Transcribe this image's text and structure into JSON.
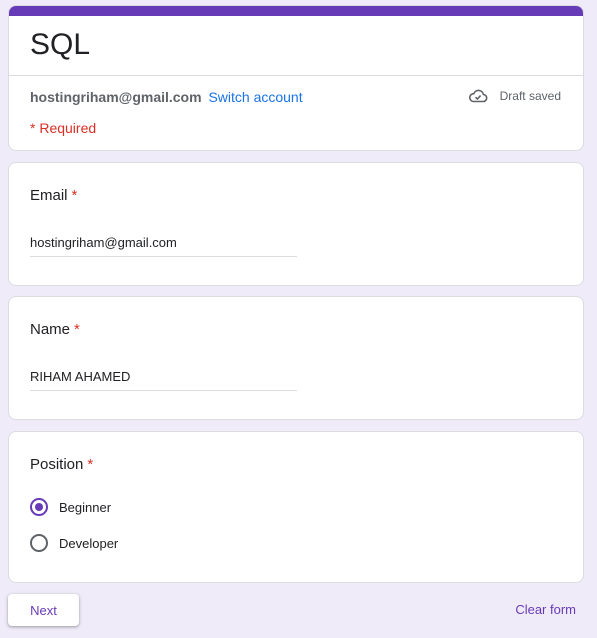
{
  "form": {
    "title": "SQL",
    "account_email": "hostingriham@gmail.com",
    "switch_account_label": "Switch account",
    "draft_status": "Draft saved",
    "required_note": "* Required",
    "accent_color": "#673ab7"
  },
  "questions": [
    {
      "label": "Email",
      "required_mark": "*",
      "value": "hostingriham@gmail.com"
    },
    {
      "label": "Name",
      "required_mark": "*",
      "value": "RIHAM AHAMED"
    },
    {
      "label": "Position",
      "required_mark": "*",
      "options": [
        {
          "label": "Beginner",
          "selected": true
        },
        {
          "label": "Developer",
          "selected": false
        }
      ]
    }
  ],
  "footer": {
    "next_label": "Next",
    "clear_label": "Clear form"
  },
  "icons": {
    "draft": "cloud-check-icon"
  }
}
